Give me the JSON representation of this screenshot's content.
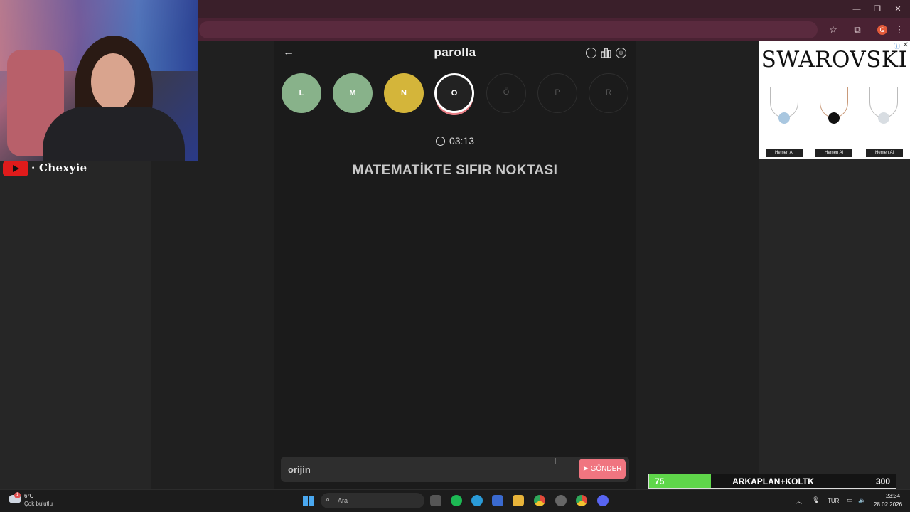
{
  "game": {
    "title": "parolla",
    "letters": [
      {
        "letter": "L",
        "state": "correct"
      },
      {
        "letter": "M",
        "state": "correct"
      },
      {
        "letter": "N",
        "state": "passed"
      },
      {
        "letter": "O",
        "state": "active"
      },
      {
        "letter": "Ö",
        "state": "pending"
      },
      {
        "letter": "P",
        "state": "pending"
      },
      {
        "letter": "R",
        "state": "pending"
      }
    ],
    "timer": "03:13",
    "question": "MATEMATİKTE SIFIR NOKTASI",
    "answer_value": "orijin",
    "send_label": "GÖNDER"
  },
  "stream": {
    "channel_name": "· Chexyie"
  },
  "ad": {
    "brand": "SWAROVSKI",
    "cta": [
      "Hemen Al",
      "Hemen Al",
      "Hemen Al"
    ]
  },
  "goal": {
    "current": "75",
    "label": "ARKAPLAN+KOLTK",
    "target": "300",
    "progress_fraction": 0.25,
    "fill_color": "#5fd64a"
  },
  "taskbar": {
    "weather_temp": "6°C",
    "weather_desc": "Çok bulutlu",
    "weather_badge": "1",
    "search_placeholder": "Ara",
    "language": "TUR",
    "time": "23:34",
    "date": "28.02.2026"
  },
  "colors": {
    "accent": "#f07580",
    "correct": "#88b28a",
    "passed": "#d4b53a"
  }
}
